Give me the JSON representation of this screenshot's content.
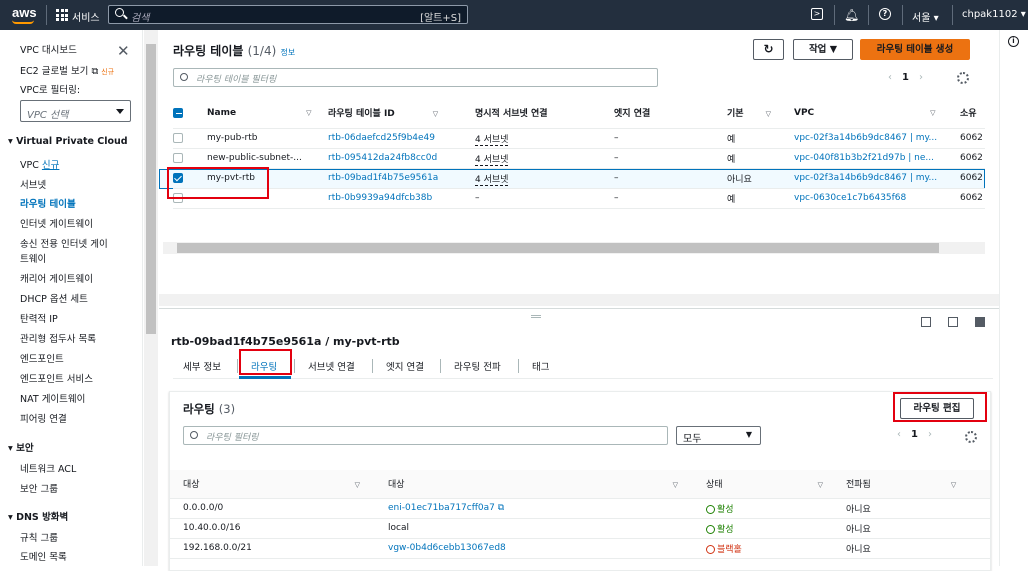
{
  "topbar": {
    "logo": "aws",
    "services": "서비스",
    "search_placeholder": "검색",
    "search_shortcut": "[알트+S]",
    "region": "서울",
    "user": "chpak1102"
  },
  "sidebar": {
    "items": [
      "VPC 대시보드",
      "EC2 글로벌 보기",
      "VPC로 필터링:",
      "VPC 선택",
      "Virtual Private Cloud",
      "VPC",
      "서브넷",
      "라우팅 테이블",
      "인터넷 게이트웨이",
      "송신 전용 인터넷 게이",
      "트웨이",
      "캐리어 게이트웨이",
      "DHCP 옵션 세트",
      "탄력적 IP",
      "관리형 접두사 목록",
      "엔드포인트",
      "엔드포인트 서비스",
      "NAT 게이트웨이",
      "피어링 연결",
      "보안",
      "네트워크 ACL",
      "보안 그룹",
      "DNS 방화벽",
      "규칙 그룹",
      "도메인 목록"
    ],
    "new_tag": "신규",
    "new_tag2": "신규"
  },
  "list": {
    "title": "라우팅 테이블",
    "count": "(1/4)",
    "info": "정보",
    "actions": "작업",
    "create": "라우팅 테이블 생성",
    "filter_placeholder": "라우팅 테이블 필터링",
    "page": "1",
    "headers": [
      "Name",
      "라우팅 테이블 ID",
      "명시적 서브넷 연결",
      "엣지 연결",
      "기본",
      "VPC",
      "소유"
    ],
    "rows": [
      [
        "my-pub-rtb",
        "rtb-06daefcd25f9b4e49",
        "4 서브넷",
        "–",
        "예",
        "vpc-02f3a14b6b9dc8467 | my...",
        "6062"
      ],
      [
        "new-public-subnet-...",
        "rtb-095412da24fb8cc0d",
        "4 서브넷",
        "–",
        "예",
        "vpc-040f81b3b2f21d97b | ne...",
        "6062"
      ],
      [
        "my-pvt-rtb",
        "rtb-09bad1f4b75e9561a",
        "4 서브넷",
        "–",
        "아니요",
        "vpc-02f3a14b6b9dc8467 | my...",
        "6062"
      ],
      [
        "–",
        "rtb-0b9939a94dfcb38b",
        "–",
        "–",
        "예",
        "vpc-0630ce1c7b6435f68",
        "6062"
      ]
    ]
  },
  "detail": {
    "title": "rtb-09bad1f4b75e9561a / my-pvt-rtb",
    "tabs": [
      "세부 정보",
      "라우팅",
      "서브넷 연결",
      "엣지 연결",
      "라우팅 전파",
      "태그"
    ],
    "routes_title": "라우팅",
    "routes_count": "(3)",
    "edit": "라우팅 편집",
    "filter_placeholder": "라우팅 필터링",
    "select": "모두",
    "page": "1",
    "headers": [
      "대상",
      "대상",
      "상태",
      "전파됨"
    ],
    "rows": [
      [
        "0.0.0.0/0",
        "eni-01ec71ba717cff0a7",
        "활성",
        "아니요"
      ],
      [
        "10.40.0.0/16",
        "local",
        "활성",
        "아니요"
      ],
      [
        "192.168.0.0/21",
        "vgw-0b4d6cebb13067ed8",
        "블랙홀",
        "아니요"
      ]
    ]
  },
  "colors": {
    "topbar": "#232f3e",
    "accent": "#ec7211",
    "link": "#0073bb",
    "highlight": "#e3000f"
  }
}
